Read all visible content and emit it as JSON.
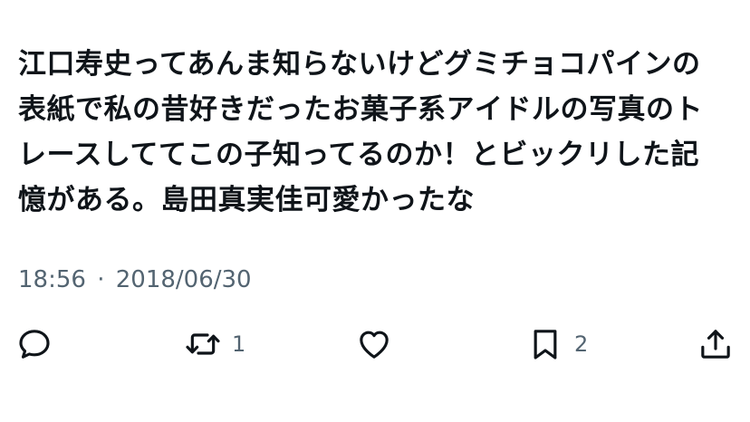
{
  "tweet": {
    "lines": [
      "江口寿史ってあんま知らないけどグミチョコパインの",
      "表紙で私の昔好きだったお菓子系アイドルの写真のト",
      "レースしててこの子知ってるのか！とビックリした記",
      "憶がある。島田真実佳可愛かったな"
    ],
    "time": "18:56",
    "separator": "·",
    "date": "2018/06/30"
  },
  "actions": {
    "reply": {
      "icon": "reply-icon",
      "count": ""
    },
    "retweet": {
      "icon": "retweet-icon",
      "count": "1"
    },
    "like": {
      "icon": "heart-icon",
      "count": ""
    },
    "bookmark": {
      "icon": "bookmark-icon",
      "count": "2"
    },
    "share": {
      "icon": "share-icon",
      "count": ""
    }
  },
  "colors": {
    "text": "#0f1419",
    "muted": "#536471",
    "background": "#ffffff"
  }
}
